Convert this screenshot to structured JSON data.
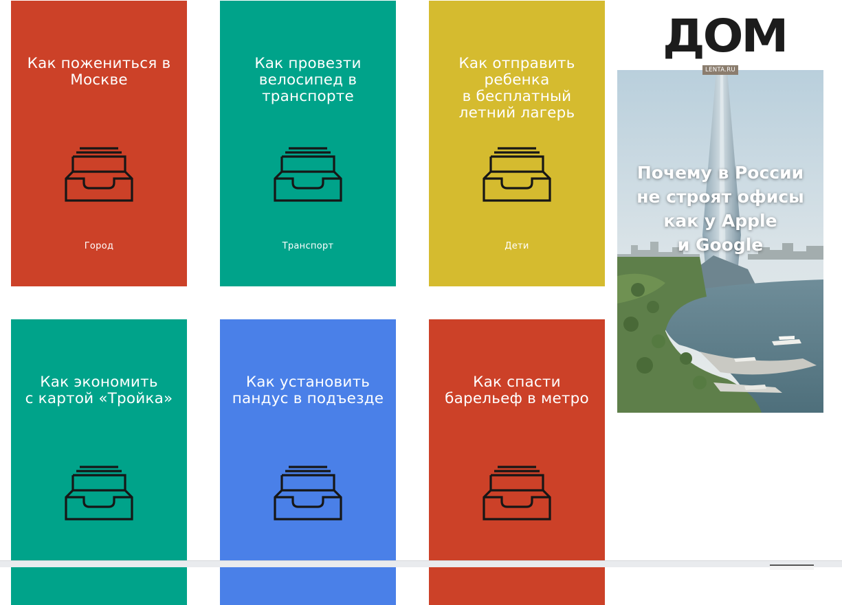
{
  "cards": [
    {
      "title": "Как пожениться в\nМоскве",
      "category": "Город",
      "color": "#cc4128"
    },
    {
      "title": "Как провезти\nвелосипед в\nтранспорте",
      "category": "Транспорт",
      "color": "#00a38a"
    },
    {
      "title": "Как отправить\nребенка\nв бесплатный\nлетний лагерь",
      "category": "Дети",
      "color": "#d5bb2f"
    },
    {
      "title": "Как экономить\nс картой «Тройка»",
      "category": "",
      "color": "#00a38a"
    },
    {
      "title": "Как установить\nпандус в подъезде",
      "category": "",
      "color": "#4a80e8"
    },
    {
      "title": "Как спасти\nбарельеф в метро",
      "category": "",
      "color": "#cc4128"
    }
  ],
  "icon": "inbox-tray-icon",
  "ad": {
    "logo": "ДОМ",
    "badge": "LENTA.RU",
    "headline": "Почему в России\nне строят офисы\nкак у Apple\nи Google"
  }
}
